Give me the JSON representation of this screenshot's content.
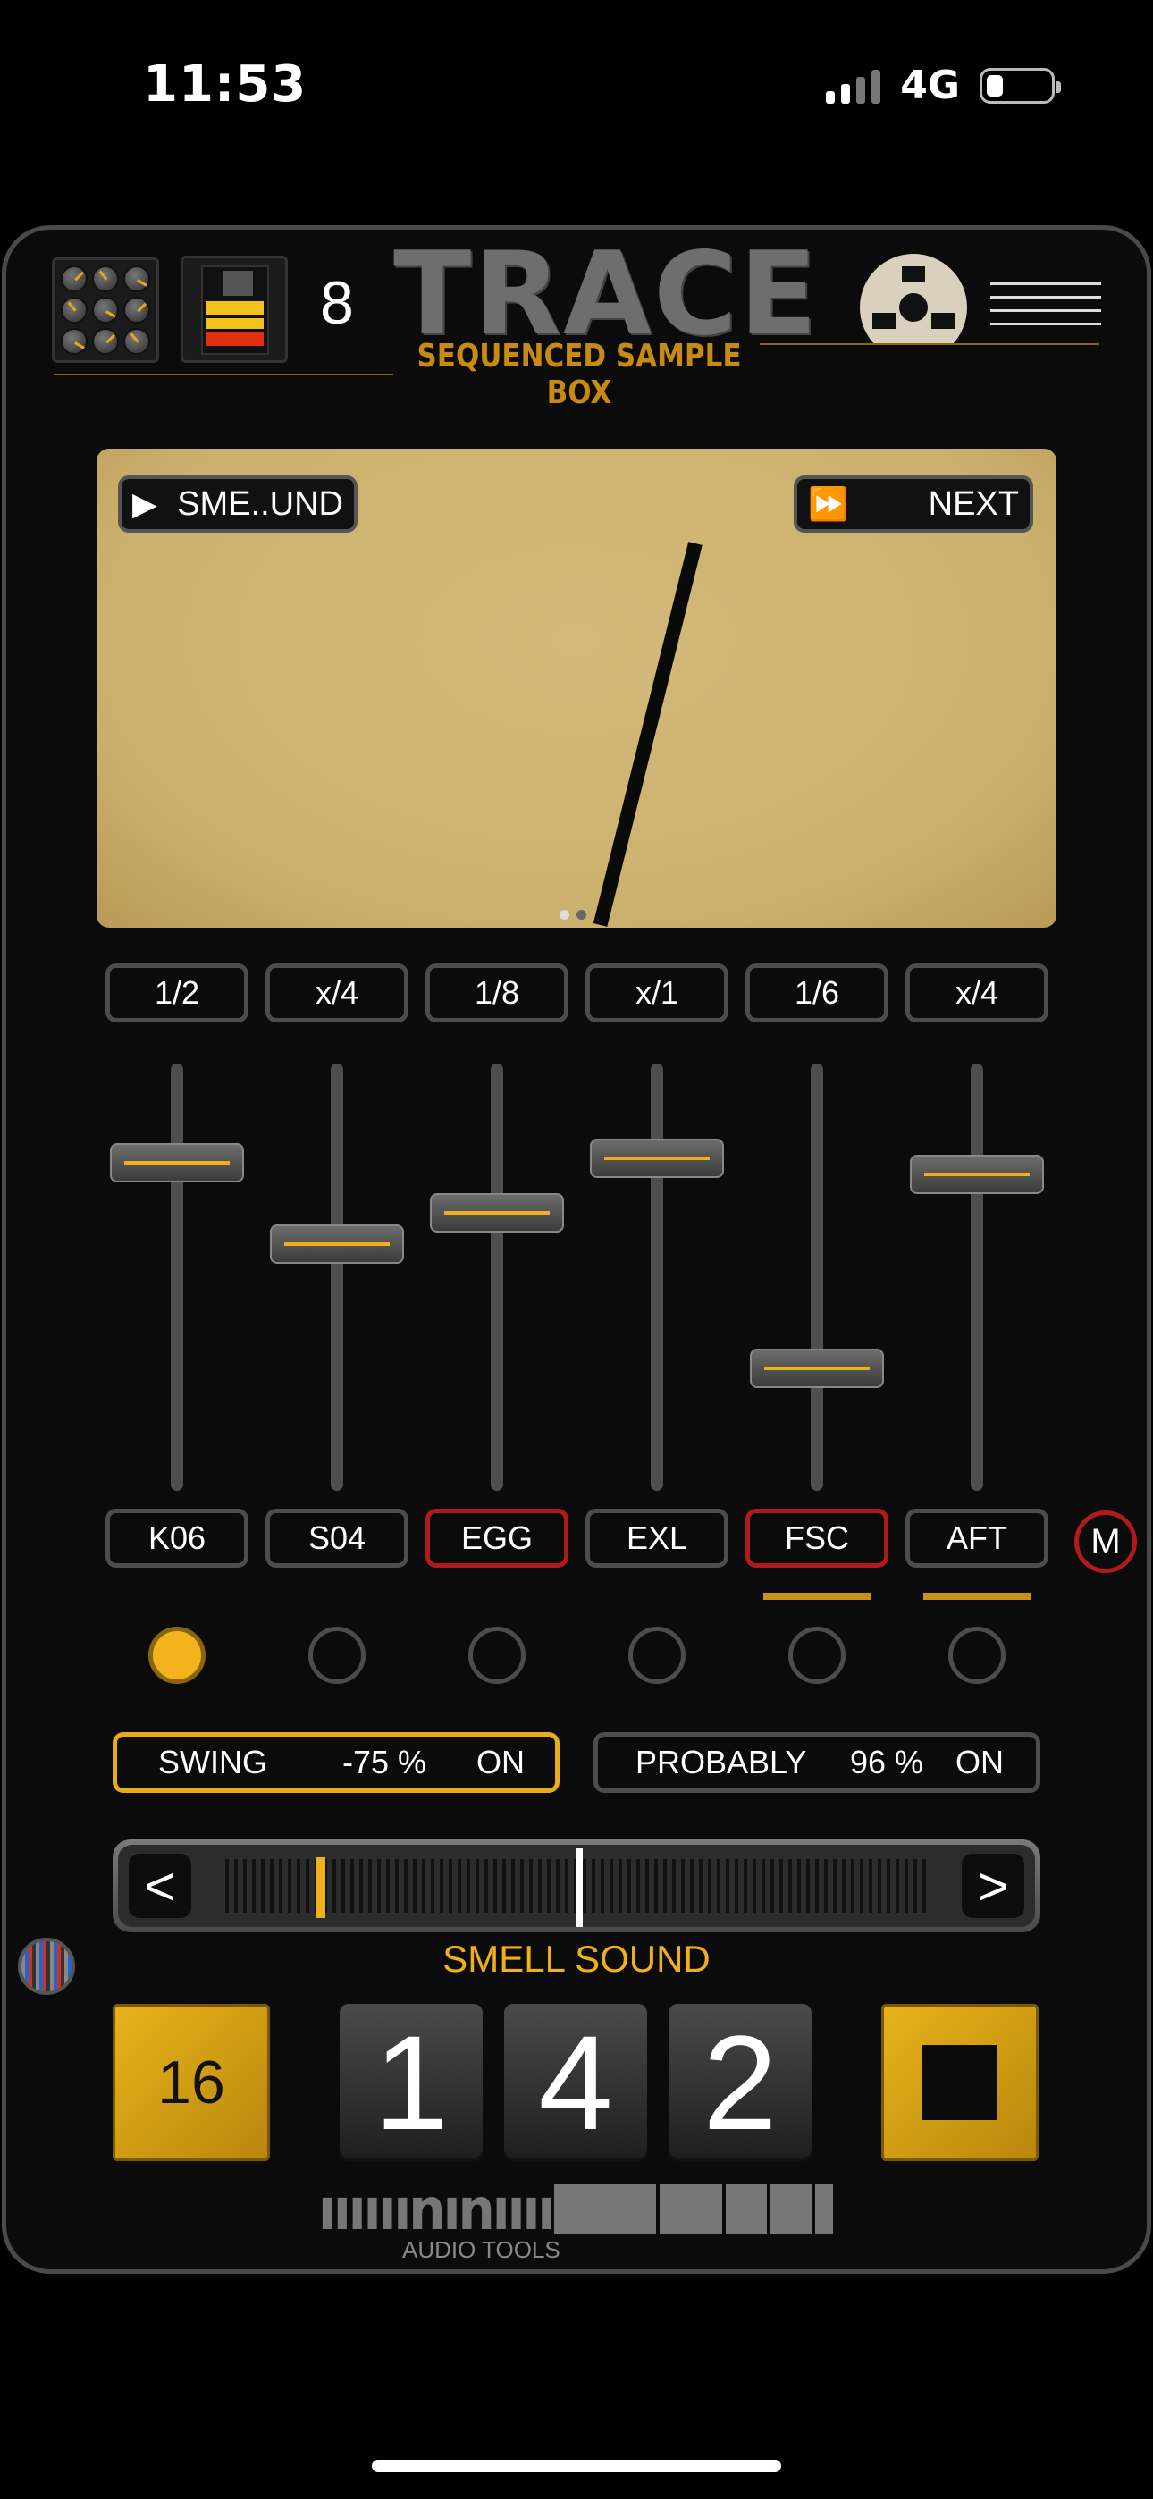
{
  "status": {
    "time": "11:53",
    "network": "4G"
  },
  "header": {
    "bank_number": "8",
    "app_title": "TRACE",
    "app_subtitle": "SEQUENCED SAMPLE BOX"
  },
  "display": {
    "play_label": "SME..UND",
    "next_label": "NEXT",
    "page_count": 2,
    "current_page": 1
  },
  "channels": [
    {
      "division": "1/2",
      "name": "K06",
      "fader_level": 0.75,
      "highlighted": false,
      "muted": true,
      "marker": false
    },
    {
      "division": "x/4",
      "name": "S04",
      "fader_level": 0.54,
      "highlighted": false,
      "muted": false,
      "marker": false
    },
    {
      "division": "1/8",
      "name": "EGG",
      "fader_level": 0.62,
      "highlighted": true,
      "muted": false,
      "marker": false
    },
    {
      "division": "x/1",
      "name": "EXL",
      "fader_level": 0.76,
      "highlighted": false,
      "muted": false,
      "marker": false
    },
    {
      "division": "1/6",
      "name": "FSC",
      "fader_level": 0.22,
      "highlighted": true,
      "muted": false,
      "marker": true
    },
    {
      "division": "x/4",
      "name": "AFT",
      "fader_level": 0.72,
      "highlighted": false,
      "muted": false,
      "marker": true
    }
  ],
  "master": {
    "label": "M"
  },
  "swing": {
    "label": "SWING",
    "value": "-75 %",
    "state": "ON"
  },
  "probably": {
    "label": "PROBABLY",
    "value": "96 %",
    "state": "ON"
  },
  "scroller": {
    "left": "<",
    "right": ">"
  },
  "sound_name": "SMELL SOUND",
  "steps": {
    "label": "16"
  },
  "counter": {
    "d1": "1",
    "d2": "4",
    "d3": "2"
  },
  "brand": {
    "sub": "AUDIO TOOLS"
  },
  "colors": {
    "accent": "#f0b018",
    "alert": "#b11a1a",
    "display_bg": "#ccb06d"
  }
}
